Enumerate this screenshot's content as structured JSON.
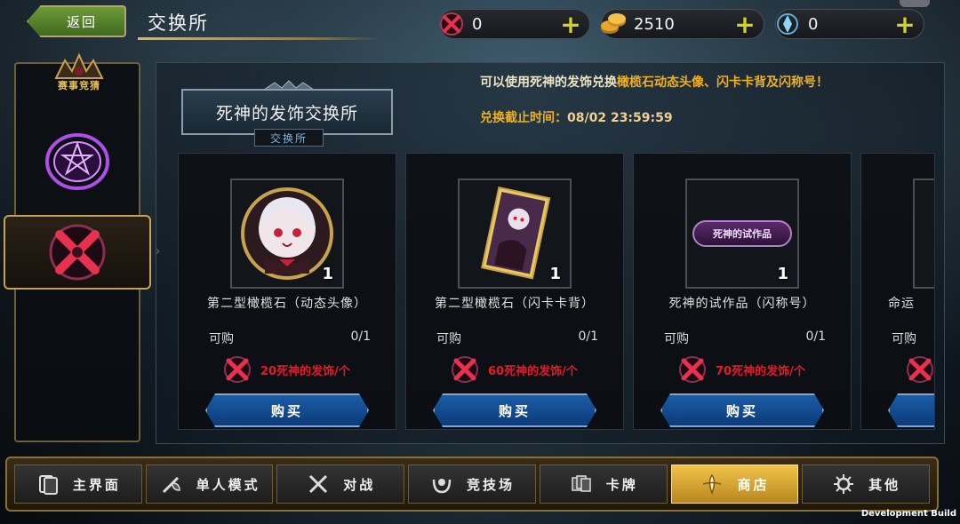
{
  "header": {
    "back_label": "返回",
    "page_title": "交换所"
  },
  "currencies": [
    {
      "icon": "scythe-emblem-icon",
      "value": "0"
    },
    {
      "icon": "gold-coin-icon",
      "value": "2510"
    },
    {
      "icon": "crystal-orb-icon",
      "value": "0"
    }
  ],
  "sidebar": {
    "crest_label": "赛事竞猜",
    "items": [
      {
        "icon": "purple-magic-circle-icon",
        "selected": false
      },
      {
        "icon": "death-ornament-icon",
        "selected": true
      }
    ]
  },
  "exchange": {
    "title": "死神的发饰交换所",
    "subtitle": "交换所",
    "desc_prefix": "可以使用死神的发饰兑换",
    "desc_highlight": "橄榄石动态头像、闪卡卡背及闪称号！",
    "deadline_label": "兑换截止时间：",
    "deadline_value": "08/02 23:59:59"
  },
  "items": [
    {
      "name": "第二型橄榄石（动态头像）",
      "qty": "1",
      "avail_label": "可购",
      "avail_value": "0/1",
      "cost": "20死神的发饰/个",
      "buy_label": "购买"
    },
    {
      "name": "第二型橄榄石（闪卡卡背）",
      "qty": "1",
      "avail_label": "可购",
      "avail_value": "0/1",
      "cost": "60死神的发饰/个",
      "buy_label": "购买"
    },
    {
      "name": "死神的试作品（闪称号）",
      "qty": "1",
      "avail_label": "可购",
      "avail_value": "0/1",
      "cost": "70死神的发饰/个",
      "buy_label": "购买",
      "thumb_text": "死神的试作品"
    },
    {
      "name": "命运",
      "avail_label": "可购"
    }
  ],
  "nav": {
    "tabs": [
      {
        "label": "主界面",
        "icon": "cards-home-icon"
      },
      {
        "label": "单人模式",
        "icon": "sword-shield-icon"
      },
      {
        "label": "对战",
        "icon": "crossed-swords-icon"
      },
      {
        "label": "竞技场",
        "icon": "arena-wreath-icon"
      },
      {
        "label": "卡牌",
        "icon": "card-deck-icon"
      },
      {
        "label": "商店",
        "icon": "shop-emblem-icon",
        "active": true
      },
      {
        "label": "其他",
        "icon": "gear-cluster-icon"
      }
    ]
  },
  "footer": {
    "build_label": "Development Build"
  },
  "colors": {
    "accent_gold": "#c9a24d",
    "highlight_orange": "#f0b020",
    "cost_red": "#e21c2a",
    "buy_blue": "#1b5da8"
  }
}
